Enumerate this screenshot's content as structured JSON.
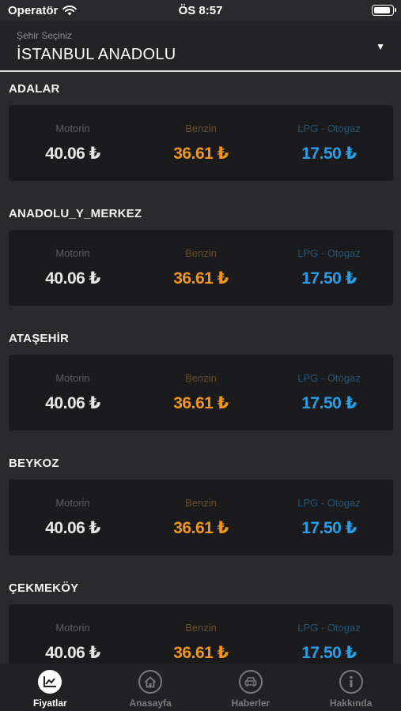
{
  "status": {
    "carrier": "Operatör",
    "time": "ÖS 8:57"
  },
  "selector": {
    "label": "Şehir Seçiniz",
    "value": "İSTANBUL ANADOLU"
  },
  "columns": {
    "diesel": "Motorin",
    "petrol": "Benzin",
    "lpg": "LPG - Otogaz"
  },
  "districts": [
    {
      "name": "ADALAR",
      "diesel": "40.06 ₺",
      "petrol": "36.61 ₺",
      "lpg": "17.50 ₺"
    },
    {
      "name": "ANADOLU_Y_MERKEZ",
      "diesel": "40.06 ₺",
      "petrol": "36.61 ₺",
      "lpg": "17.50 ₺"
    },
    {
      "name": "ATAŞEHİR",
      "diesel": "40.06 ₺",
      "petrol": "36.61 ₺",
      "lpg": "17.50 ₺"
    },
    {
      "name": "BEYKOZ",
      "diesel": "40.06 ₺",
      "petrol": "36.61 ₺",
      "lpg": "17.50 ₺"
    },
    {
      "name": "ÇEKMEKÖY",
      "diesel": "40.06 ₺",
      "petrol": "36.61 ₺",
      "lpg": "17.50 ₺"
    }
  ],
  "tabs": [
    {
      "label": "Fiyatlar",
      "icon": "chart-icon",
      "active": true
    },
    {
      "label": "Anasayfa",
      "icon": "home-icon",
      "active": false
    },
    {
      "label": "Haberler",
      "icon": "car-icon",
      "active": false
    },
    {
      "label": "Hakkında",
      "icon": "info-icon",
      "active": false
    }
  ],
  "colors": {
    "diesel": "#e6e6e6",
    "petrol": "#f0961e",
    "lpg": "#2a9ee6",
    "background": "#2a2a2c"
  }
}
